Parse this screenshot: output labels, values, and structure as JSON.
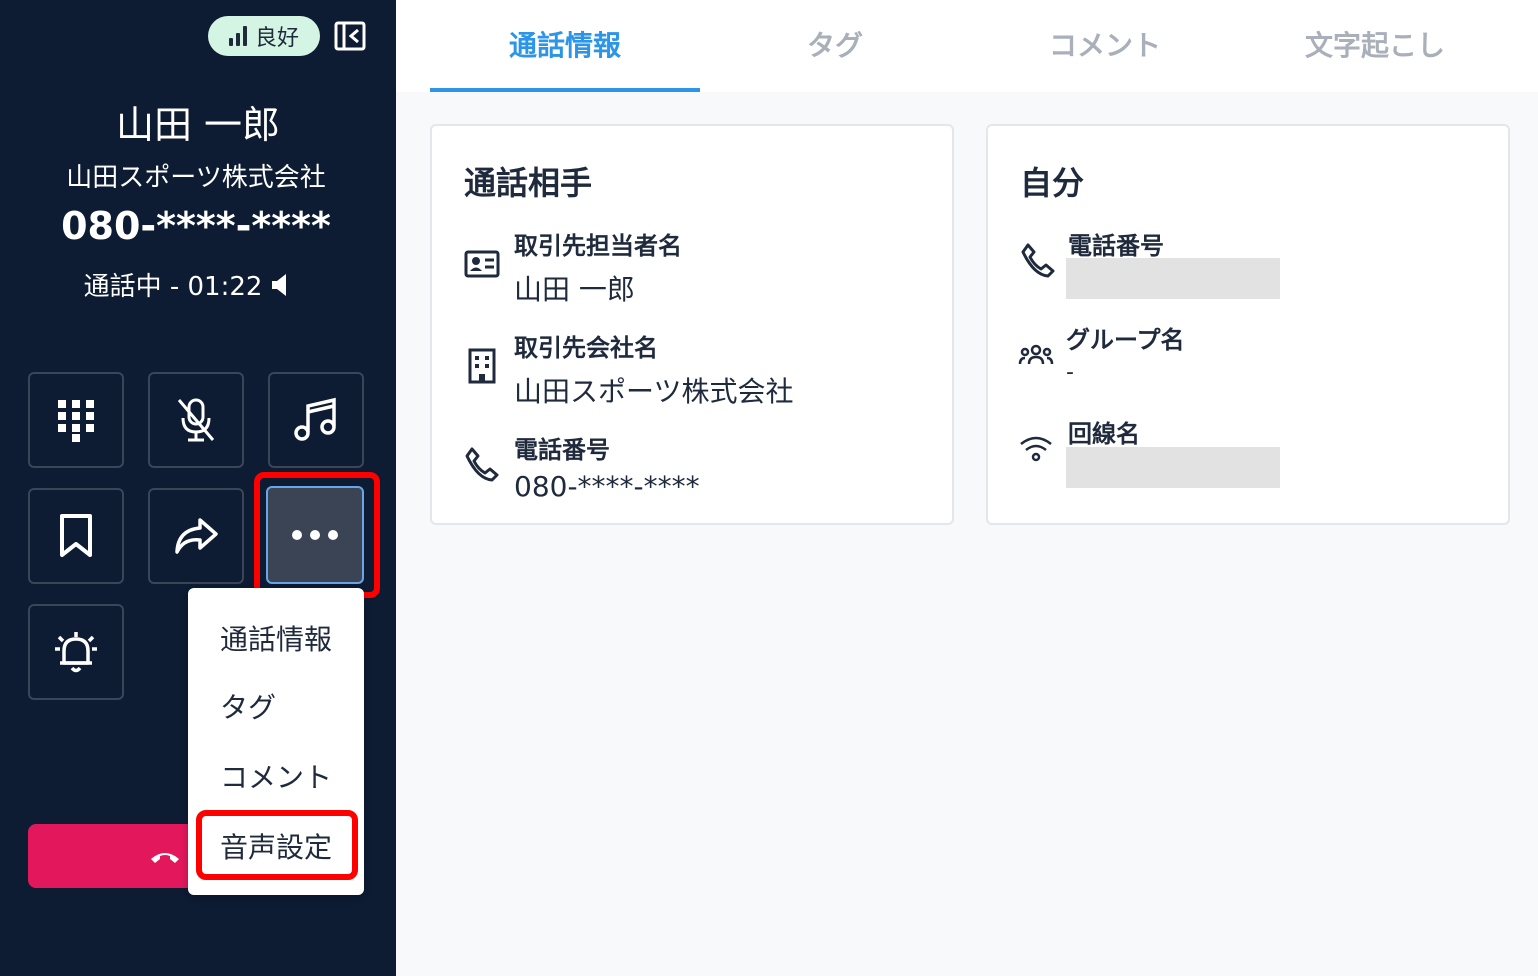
{
  "quality": {
    "label": "良好"
  },
  "caller": {
    "name": "山田 一郎",
    "company": "山田スポーツ株式会社",
    "phone": "080-****-****",
    "status": "通話中 - 01:22"
  },
  "menu": {
    "items": [
      "通話情報",
      "タグ",
      "コメント",
      "音声設定"
    ]
  },
  "tabs": [
    "通話情報",
    "タグ",
    "コメント",
    "文字起こし"
  ],
  "partner_card": {
    "title": "通話相手",
    "contact_label": "取引先担当者名",
    "contact_value": "山田 一郎",
    "company_label": "取引先会社名",
    "company_value": "山田スポーツ株式会社",
    "phone_label": "電話番号",
    "phone_value": "080-****-****"
  },
  "self_card": {
    "title": "自分",
    "phone_label": "電話番号",
    "group_label": "グループ名",
    "group_value": "-",
    "line_label": "回線名"
  },
  "colors": {
    "accent": "#2c95e8",
    "hangup": "#e3185c",
    "panel": "#0d1b33",
    "highlight": "#ff0000"
  }
}
